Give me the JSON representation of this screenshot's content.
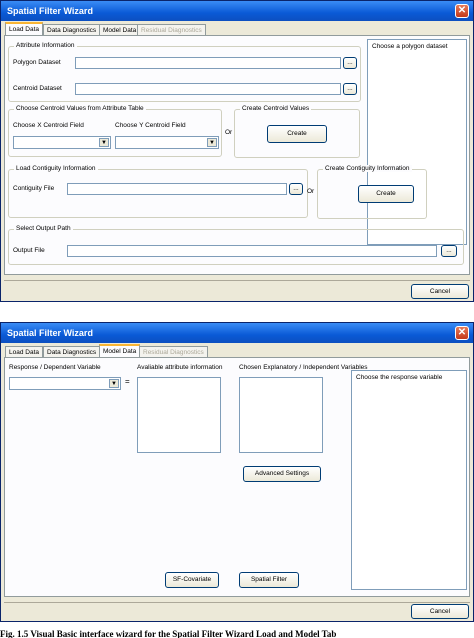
{
  "window1": {
    "title": "Spatial Filter Wizard",
    "close_glyph": "✕",
    "tabs": [
      {
        "label": "Load Data"
      },
      {
        "label": "Data Diagnostics"
      },
      {
        "label": "Model Data"
      },
      {
        "label": "Residual Diagnostics"
      }
    ],
    "active_tab": "Load Data",
    "attribute_group": {
      "title": "Attribute Information",
      "polygon_label": "Polygon Dataset",
      "polygon_value": "",
      "centroid_label": "Centroid Dataset",
      "centroid_value": "",
      "browse": "..."
    },
    "info_text": "Choose a polygon dataset",
    "centroid_values_group": {
      "title": "Choose Centroid Values from Attribute Table",
      "x_label": "Choose X Centroid Field",
      "y_label": "Choose Y Centroid Field",
      "x_value": "",
      "y_value": ""
    },
    "or_text": "Or",
    "create_centroid_group": {
      "title": "Create Centroid Values",
      "button": "Create"
    },
    "contiguity_group": {
      "title": "Load Contiguity Information",
      "file_label": "Contiguity File",
      "file_value": "",
      "browse": "..."
    },
    "create_contiguity_group": {
      "title": "Create Contiguity Information",
      "button": "Create"
    },
    "output_group": {
      "title": "Select Output Path",
      "file_label": "Output File",
      "file_value": "",
      "browse": "..."
    },
    "cancel": "Cancel"
  },
  "window2": {
    "title": "Spatial Filter Wizard",
    "close_glyph": "✕",
    "tabs": [
      {
        "label": "Load Data"
      },
      {
        "label": "Data Diagnostics"
      },
      {
        "label": "Model Data"
      },
      {
        "label": "Residual Diagnostics"
      }
    ],
    "active_tab": "Model Data",
    "response_label": "Response / Dependent Variable",
    "response_value": "",
    "equals": "=",
    "available_label": "Avaliable attribute information",
    "chosen_label": "Chosen Explanatory / Independent Variables",
    "info_text": "Choose the response variable",
    "advanced_button": "Advanced Settings",
    "sf_covariate_button": "SF-Covariate",
    "spatial_filter_button": "Spatial Filter",
    "cancel": "Cancel"
  },
  "caption": "Fig. 1.5 Visual Basic interface wizard for the Spatial Filter Wizard Load and Model Tab"
}
